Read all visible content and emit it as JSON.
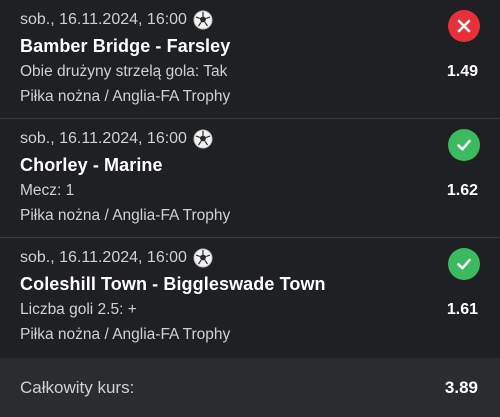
{
  "bets": [
    {
      "date": "sob., 16.11.2024, 16:00",
      "match": "Bamber Bridge - Farsley",
      "market": "Obie drużyny strzelą gola: Tak",
      "league": "Piłka nożna / Anglia-FA Trophy",
      "odds": "1.49",
      "status": "lost",
      "status_icon": "close-icon"
    },
    {
      "date": "sob., 16.11.2024, 16:00",
      "match": "Chorley - Marine",
      "market": "Mecz: 1",
      "league": "Piłka nożna / Anglia-FA Trophy",
      "odds": "1.62",
      "status": "won",
      "status_icon": "check-icon"
    },
    {
      "date": "sob., 16.11.2024, 16:00",
      "match": "Coleshill Town - Biggleswade Town",
      "market": "Liczba goli 2.5: +",
      "league": "Piłka nożna / Anglia-FA Trophy",
      "odds": "1.61",
      "status": "won",
      "status_icon": "check-icon"
    }
  ],
  "footer": {
    "label": "Całkowity kurs:",
    "value": "3.89"
  },
  "colors": {
    "background": "#1f2023",
    "footer_background": "#2b2c30",
    "lost": "#e8303a",
    "won": "#3cba5f"
  }
}
